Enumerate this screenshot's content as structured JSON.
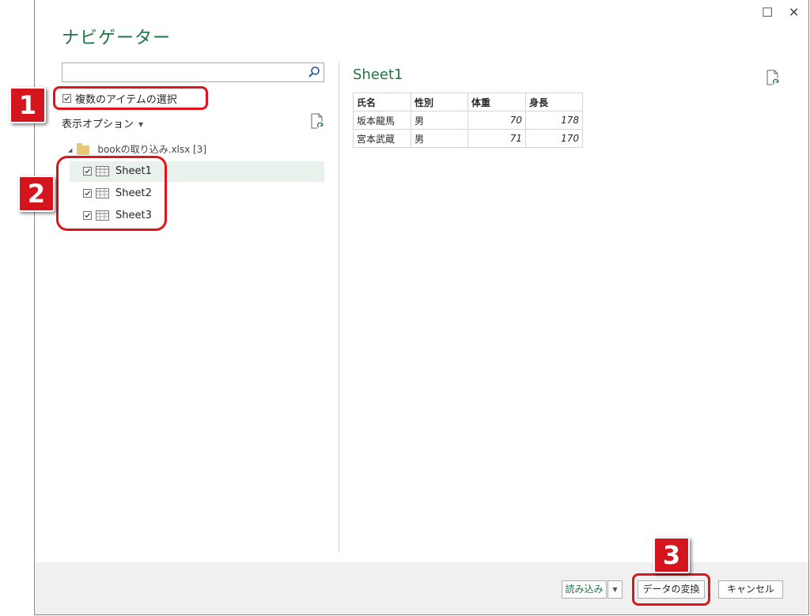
{
  "window": {
    "title": "ナビゲーター",
    "maximize_glyph": "☐",
    "close_glyph": "✕"
  },
  "search": {
    "placeholder": "",
    "icon": "search-icon"
  },
  "multi_select": {
    "label": "複数のアイテムの選択",
    "checked": true
  },
  "display_options": {
    "label": "表示オプション",
    "arrow": "▼"
  },
  "tree": {
    "root": {
      "label": "bookの取り込み.xlsx [3]",
      "icon": "folder-icon",
      "expanded": true
    },
    "items": [
      {
        "label": "Sheet1",
        "checked": true,
        "selected": true
      },
      {
        "label": "Sheet2",
        "checked": true,
        "selected": false
      },
      {
        "label": "Sheet3",
        "checked": true,
        "selected": false
      }
    ]
  },
  "preview": {
    "title": "Sheet1",
    "columns": [
      "氏名",
      "性別",
      "体重",
      "身長"
    ],
    "rows": [
      [
        "坂本龍馬",
        "男",
        "70",
        "178"
      ],
      [
        "宮本武蔵",
        "男",
        "71",
        "170"
      ]
    ]
  },
  "footer": {
    "load_label": "読み込み",
    "load_dropdown": "▼",
    "transform_label": "データの変換",
    "cancel_label": "キャンセル"
  },
  "annotations": {
    "badge1": "1",
    "badge2": "2",
    "badge3": "3",
    "color": "#d5151d"
  },
  "colors": {
    "accent": "#217346",
    "highlight": "#e0141e"
  }
}
